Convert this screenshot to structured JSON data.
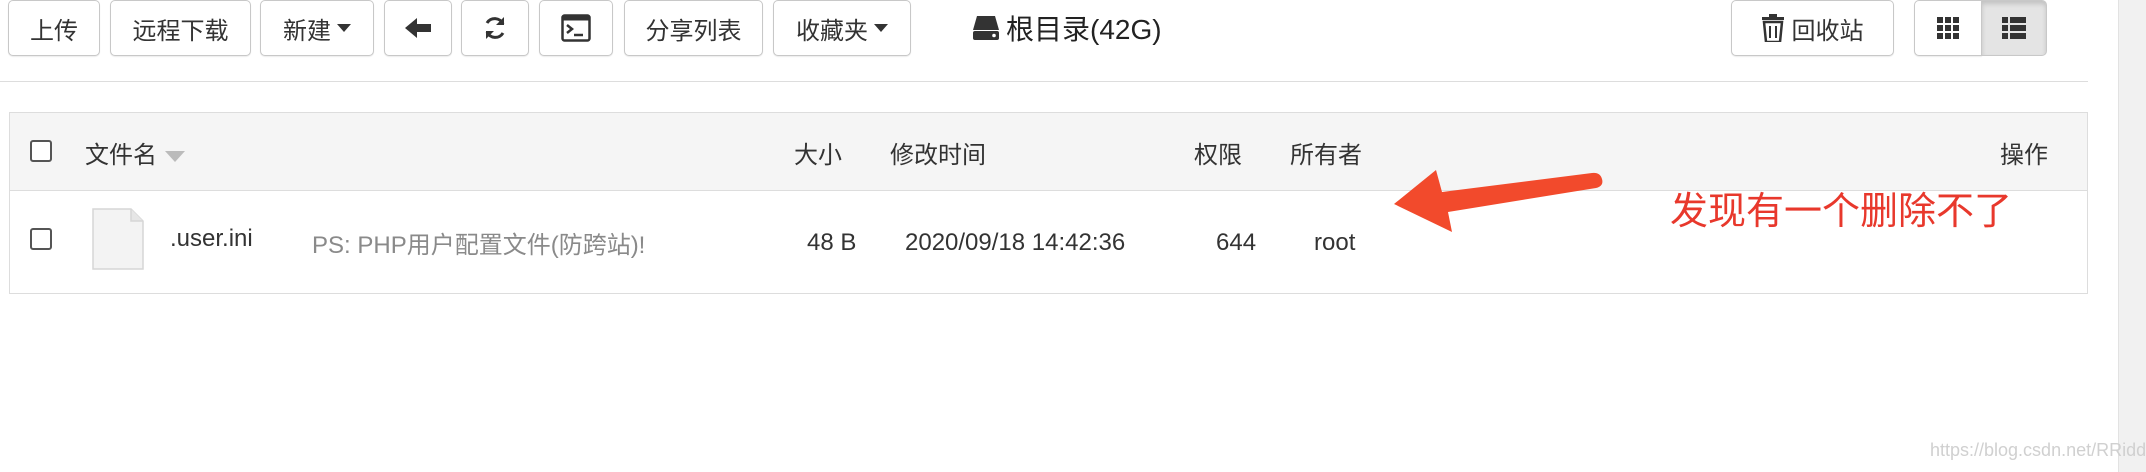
{
  "toolbar": {
    "upload": "上传",
    "remote_download": "远程下载",
    "new": "新建",
    "share_list": "分享列表",
    "favorites": "收藏夹",
    "recycle_bin": "回收站"
  },
  "drive": {
    "label": "根目录(42G)"
  },
  "table": {
    "columns": {
      "name": "文件名",
      "size": "大小",
      "modified": "修改时间",
      "permission": "权限",
      "owner": "所有者",
      "actions": "操作"
    },
    "rows": [
      {
        "name": ".user.ini",
        "note": "PS: PHP用户配置文件(防跨站)!",
        "size": "48 B",
        "modified": "2020/09/18 14:42:36",
        "permission": "644",
        "owner": "root"
      }
    ]
  },
  "annotation": {
    "text": "发现有一个删除不了",
    "color": "#e8382c"
  },
  "watermark": "https://blog.csdn.net/RRiddle",
  "icons": [
    "arrow-left-icon",
    "refresh-icon",
    "terminal-icon",
    "drive-icon",
    "trash-icon",
    "grid-view-icon",
    "list-view-icon",
    "file-icon",
    "annotation-arrow"
  ]
}
